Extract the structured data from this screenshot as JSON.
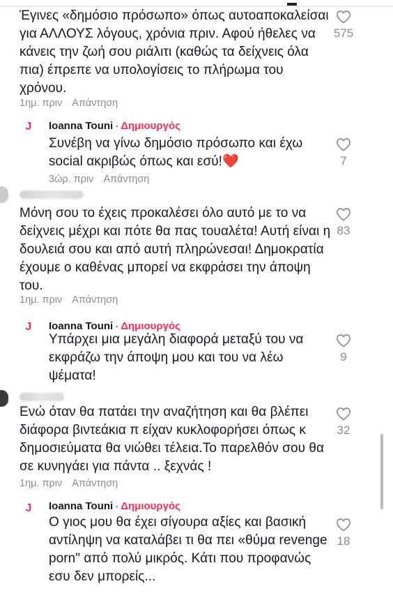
{
  "comments": [
    {
      "text_lines": [
        "Έγινες «δημόσιο πρόσωπο» όπως αυτοαποκαλείσαι",
        "για ΑΛΛΟΥΣ λόγους, χρόνια πριν. Αφού ήθελες να",
        "κάνεις την ζωή σου ριάλιτι (καθώς τα δείχνεις όλα",
        "πια) έπρεπε να υπολογίσεις το πλήρωμα του",
        "χρόνου."
      ],
      "time": "1ημ. πριν",
      "reply": "Απάντηση",
      "likes": "575"
    },
    {
      "author": "Ioanna Touni",
      "badge": "Δημιουργός",
      "avatar_letter": "J",
      "text_lines": [
        "Συνέβη να γίνω δημόσιο πρόσωπο και έχω",
        "social ακριβώς όπως και εσύ!❤️"
      ],
      "time": "3ώρ. πριν",
      "reply": "Απάντηση",
      "likes": "7"
    },
    {
      "text_lines": [
        "Μόνη σου το έχεις προκαλέσει όλο αυτό με το να",
        "δείχνεις μέχρι και πότε θα πας τουαλέτα! Αυτή είναι η",
        "δουλειά σου και από αυτή πληρώνεσαι! Δημοκρατία",
        "έχουμε ο καθένας μπορεί να εκφράσει την άποψη",
        "του."
      ],
      "time": "1ημ. πριν",
      "reply": "Απάντηση",
      "likes": "83"
    },
    {
      "author": "Ioanna Touni",
      "badge": "Δημιουργός",
      "avatar_letter": "J",
      "text_lines": [
        "Υπάρχει μια μεγάλη διαφορά μεταξύ του να",
        "εκφράζω την άποψη μου και του να λέω",
        "ψέματα!"
      ],
      "likes": "9"
    },
    {
      "text_lines": [
        "Ενώ όταν θα πατάει την αναζήτηση και θα βλέπει",
        "διάφορα βιντεάκια π είχαν κυκλοφορήσει όπως κ",
        "δημοσιεύματα θα νιώθει τέλεια.Το παρελθόν σου θα",
        "σε κυνηγάει για πάντα .. ξεχνάς !"
      ],
      "time": "1ημ. πριν",
      "reply": "Απάντηση",
      "likes": "32"
    },
    {
      "author": "Ioanna Touni",
      "badge": "Δημιουργός",
      "avatar_letter": "J",
      "text_lines": [
        "Ο γιος μου θα έχει σίγουρα αξίες και βασική",
        "αντίληψη να καταλάβει τι θα πει «θύμα revenge",
        "porn\" από πολύ μικρός. Κάτι που προφανώς",
        "εσυ δεν μπορείς..."
      ],
      "likes": "18"
    }
  ],
  "icons": {
    "like": "heart-outline-icon"
  },
  "colors": {
    "creator_badge": "#fe2c55",
    "muted": "#8a8b91"
  }
}
